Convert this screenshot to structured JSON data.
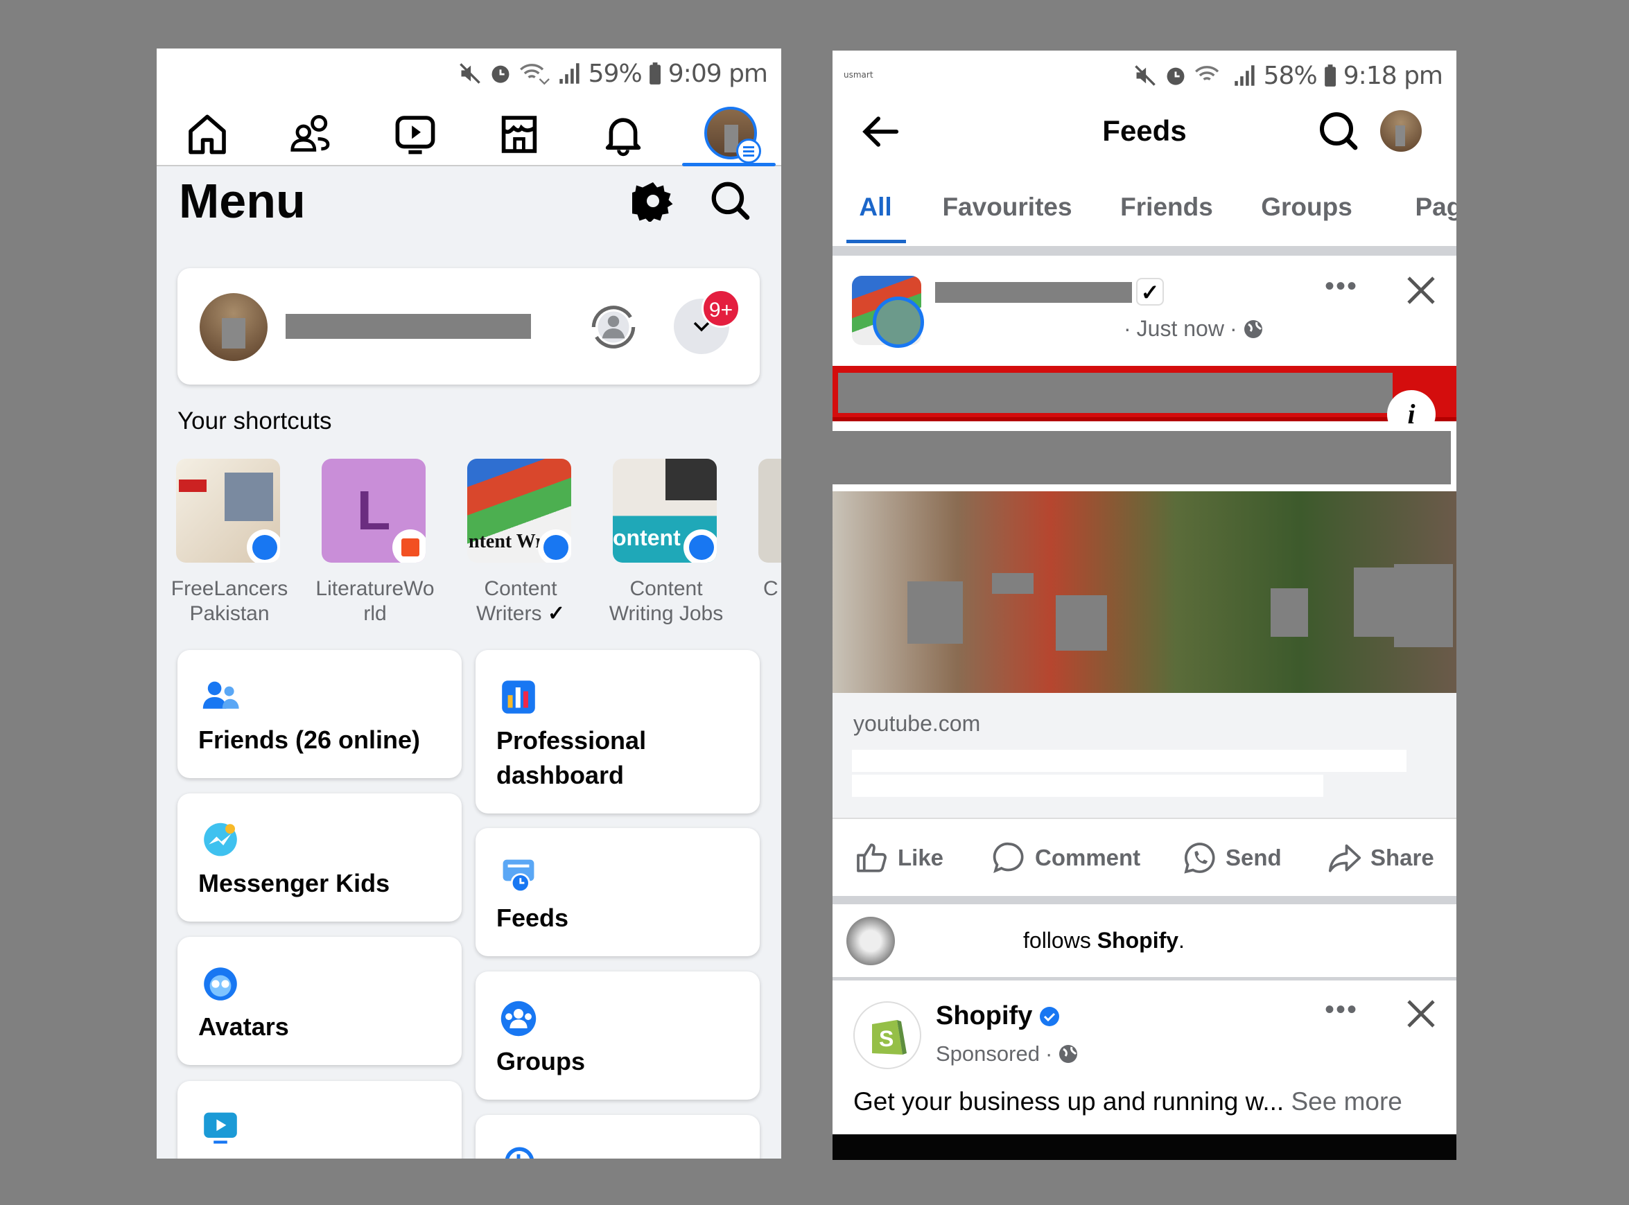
{
  "left_screen": {
    "status": {
      "battery": "59%",
      "time": "9:09 pm"
    },
    "nav_icons": [
      "home-icon",
      "friends-icon",
      "video-icon",
      "marketplace-icon",
      "bell-icon",
      "profile-menu-icon"
    ],
    "title": "Menu",
    "profile_card": {
      "notification_badge": "9+"
    },
    "shortcuts_heading": "Your shortcuts",
    "shortcuts": [
      {
        "label": "FreeLancers Pakistan"
      },
      {
        "label": "LiteratureWorld",
        "letter": "L"
      },
      {
        "label": "Content Writers",
        "verified": "✓",
        "thumb_text": "ntent Wr"
      },
      {
        "label": "Content Writing Jobs",
        "thumb_text": "ontent"
      },
      {
        "label": "C"
      }
    ],
    "menu_left": [
      {
        "label": "Friends (26 online)",
        "icon": "friends-icon"
      },
      {
        "label": "Messenger Kids",
        "icon": "messenger-kids-icon"
      },
      {
        "label": "Avatars",
        "icon": "avatars-icon"
      },
      {
        "label": "",
        "icon": "video-icon"
      }
    ],
    "menu_right": [
      {
        "label": "Professional dashboard",
        "icon": "dashboard-icon"
      },
      {
        "label": "Feeds",
        "icon": "feeds-icon"
      },
      {
        "label": "Groups",
        "icon": "groups-icon"
      },
      {
        "label": "",
        "icon": "memories-icon"
      }
    ]
  },
  "right_screen": {
    "status": {
      "carrier": "usmart",
      "battery": "58%",
      "time": "9:18 pm"
    },
    "header_title": "Feeds",
    "tabs": [
      "All",
      "Favourites",
      "Friends",
      "Groups",
      "Pages"
    ],
    "active_tab": "All",
    "post": {
      "time": "Just now",
      "verified": "✓",
      "link_domain": "youtube.com"
    },
    "actions": [
      "Like",
      "Comment",
      "Send",
      "Share"
    ],
    "activity": {
      "text": "follows ",
      "page": "Shopify",
      "suffix": "."
    },
    "ad": {
      "name": "Shopify",
      "sponsored": "Sponsored",
      "body": "Get your business up and running w...",
      "see_more": "See more"
    },
    "colors": {
      "accent": "#1877f2",
      "tab_active": "#1b66c9",
      "badge": "#e41e3f"
    }
  }
}
